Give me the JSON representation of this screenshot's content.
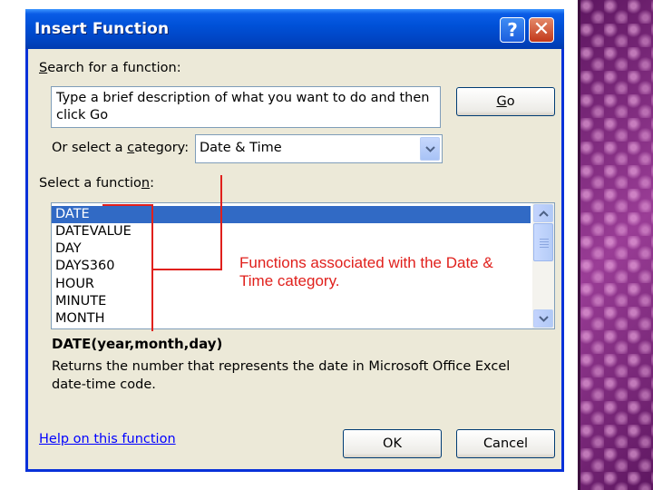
{
  "dialog": {
    "title": "Insert Function",
    "help_btn": "?",
    "close_btn": "✕"
  },
  "search": {
    "label_pre": "",
    "label_key": "S",
    "label_post": "earch for a function:",
    "text": "Type a brief description of what you want to do and then click Go",
    "go_key": "G",
    "go_post": "o"
  },
  "category": {
    "label_pre": "Or select a ",
    "label_key": "c",
    "label_post": "ategory:",
    "value": "Date & Time"
  },
  "functions": {
    "label_pre": "Select a functio",
    "label_key": "n",
    "label_post": ":",
    "items": [
      "DATE",
      "DATEVALUE",
      "DAY",
      "DAYS360",
      "HOUR",
      "MINUTE",
      "MONTH"
    ],
    "selected": "DATE"
  },
  "details": {
    "syntax": "DATE(year,month,day)",
    "description": "Returns the number that represents the date in Microsoft Office Excel date-time code."
  },
  "footer": {
    "help_link": "Help on this function",
    "ok": "OK",
    "cancel": "Cancel"
  },
  "annotation": {
    "text": "Functions associated with the Date & Time category.",
    "color": "#e0201c"
  },
  "colors": {
    "titlebar": "#0054e3",
    "dialog_bg": "#ece9d8",
    "selection": "#316ac5",
    "link": "#0000ff"
  }
}
